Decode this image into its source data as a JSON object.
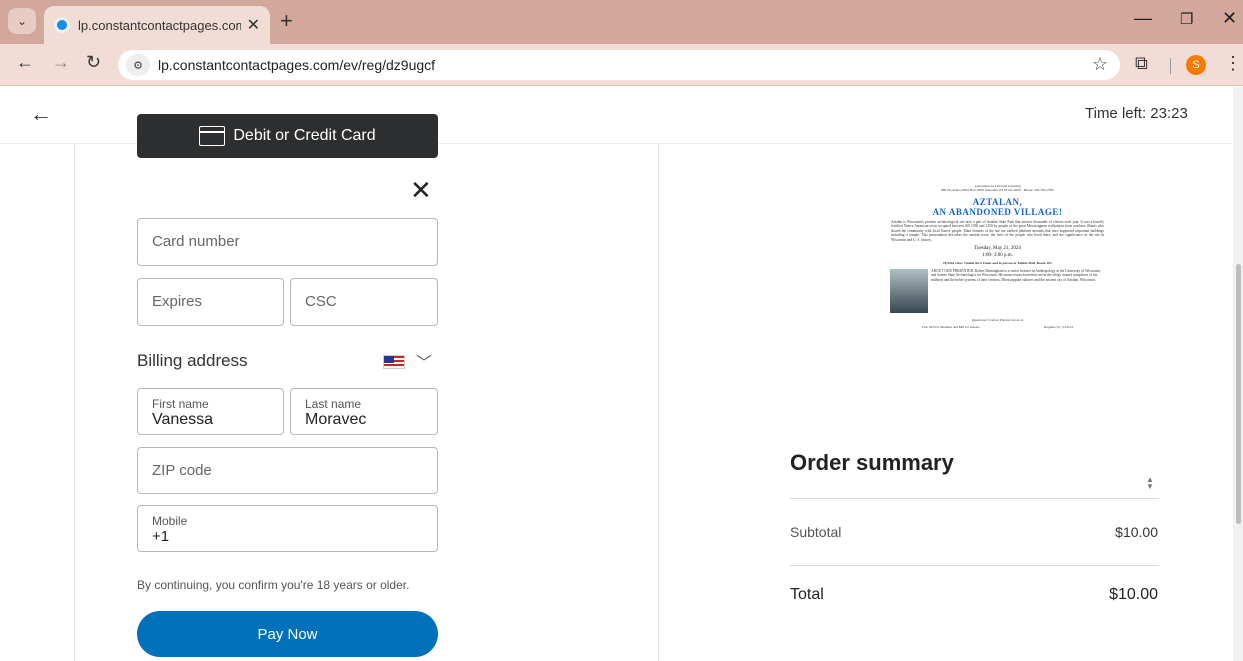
{
  "browser": {
    "tab_title": "lp.constantcontactpages.com/e",
    "url": "lp.constantcontactpages.com/ev/reg/dz9ugcf",
    "profile_initial": "S"
  },
  "page": {
    "time_left": "Time left: 23:23"
  },
  "payment": {
    "card_button_label": "Debit or Credit Card",
    "card_number_placeholder": "Card number",
    "expires_placeholder": "Expires",
    "csc_placeholder": "CSC",
    "billing_address_label": "Billing address",
    "first_name_label": "First name",
    "first_name_value": "Vanessa",
    "last_name_label": "Last name",
    "last_name_value": "Moravec",
    "zip_placeholder": "ZIP code",
    "mobile_label": "Mobile",
    "mobile_value": "+1",
    "disclaimer": "By continuing, you confirm you're 18 years or older.",
    "pay_button_label": "Pay Now"
  },
  "flyer": {
    "org": "Adventures in Lifelong Learning",
    "contact": "869 Wood Road/PO Box 2000, Kenosha WI 53141-2000 · Phone: 262-595-2765",
    "title_line1": "AZTALAN,",
    "title_line2": "AN ABANDONED VILLAGE!",
    "description": "Aztalan is Wisconsin's premier archaeological site now a part of Aztalan State Park that attracts thousands of visitors each year. It was a heavily fortified Native American town occupied between AD 1050 and 1250 by people of the great Mississippian civilization from southern Illinois who shared the community with local Native people. Main features of the site are earthen platform mounds that once supported important buildings including a temple. This presentation describes the ancient town, the lives of the people who lived there, and the significance of the site in Wisconsin and U. S. history.",
    "date": "Tuesday, May 21, 2024",
    "time": "1:00- 3:00 p.m.",
    "format": "Hybrid class: Online thru Zoom and in person at Tallent Hall, Room 182",
    "bio": "ABOUT OUR PRESENTER: Robert Birmingham is a senior lecturer in Anthropology at the University of Wisconsin, and former State Archaeologist for Wisconsin. His main research interests are in the effigy mound complexes of the midwest and the belief systems of their creators, Mississippian cultures and the ancient city of Aztalan, Wisconsin.",
    "questions": "Questions? Contact Patricia Gross at",
    "fee": "Fee: $10 for Member and $20 for Guests",
    "register_by": "Register by: 5/14/24"
  },
  "order": {
    "title": "Order summary",
    "subtotal_label": "Subtotal",
    "subtotal_value": "$10.00",
    "total_label": "Total",
    "total_value": "$10.00"
  }
}
